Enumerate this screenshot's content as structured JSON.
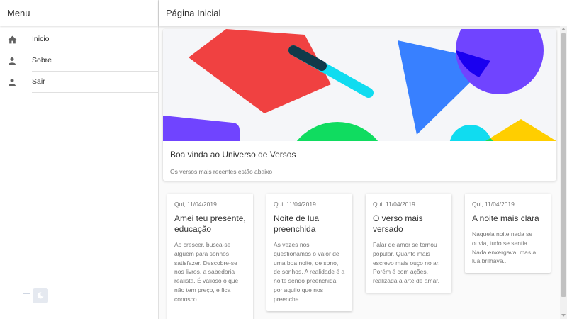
{
  "sidebar": {
    "title": "Menu",
    "items": [
      {
        "label": "Inicio",
        "icon": "home-icon"
      },
      {
        "label": "Sobre",
        "icon": "person-icon"
      },
      {
        "label": "Sair",
        "icon": "person-icon"
      }
    ]
  },
  "header": {
    "title": "Página Inicial"
  },
  "hero": {
    "title": "Boa vinda ao Universo de Versos",
    "subtitle": "Os versos mais recentes estão abaixo"
  },
  "posts": [
    {
      "date": "Qui, 11/04/2019",
      "title": "Amei teu presente, educação",
      "text": "Ao crescer, busca-se alguém para sonhos satisfazer. Descobre-se nos livros, a sabedoria realista. É valioso o que não tem preço, e fica conosco"
    },
    {
      "date": "Qui, 11/04/2019",
      "title": "Noite de lua preenchida",
      "text": "As vezes nos questionamos o valor de uma boa noite, de sono, de sonhos. A realidade é a noite sendo preenchida por aquilo que nos preenche."
    },
    {
      "date": "Qui, 11/04/2019",
      "title": "O verso mais versado",
      "text": "Falar de amor se tornou popular. Quanto mais escrevo mais ouço no ar. Porém é com ações, realizada a arte de amar."
    },
    {
      "date": "Qui, 11/04/2019",
      "title": "A noite mais clara",
      "text": "Naquela noite nada se ouvia, tudo se sentia. Nada enxergava, mas a lua brilhava.."
    }
  ],
  "colors": {
    "red": "#f04141",
    "purple": "#7044ff",
    "blue": "#3880ff",
    "cyan": "#10dcf0",
    "green": "#10dc60",
    "yellow": "#ffce00"
  }
}
